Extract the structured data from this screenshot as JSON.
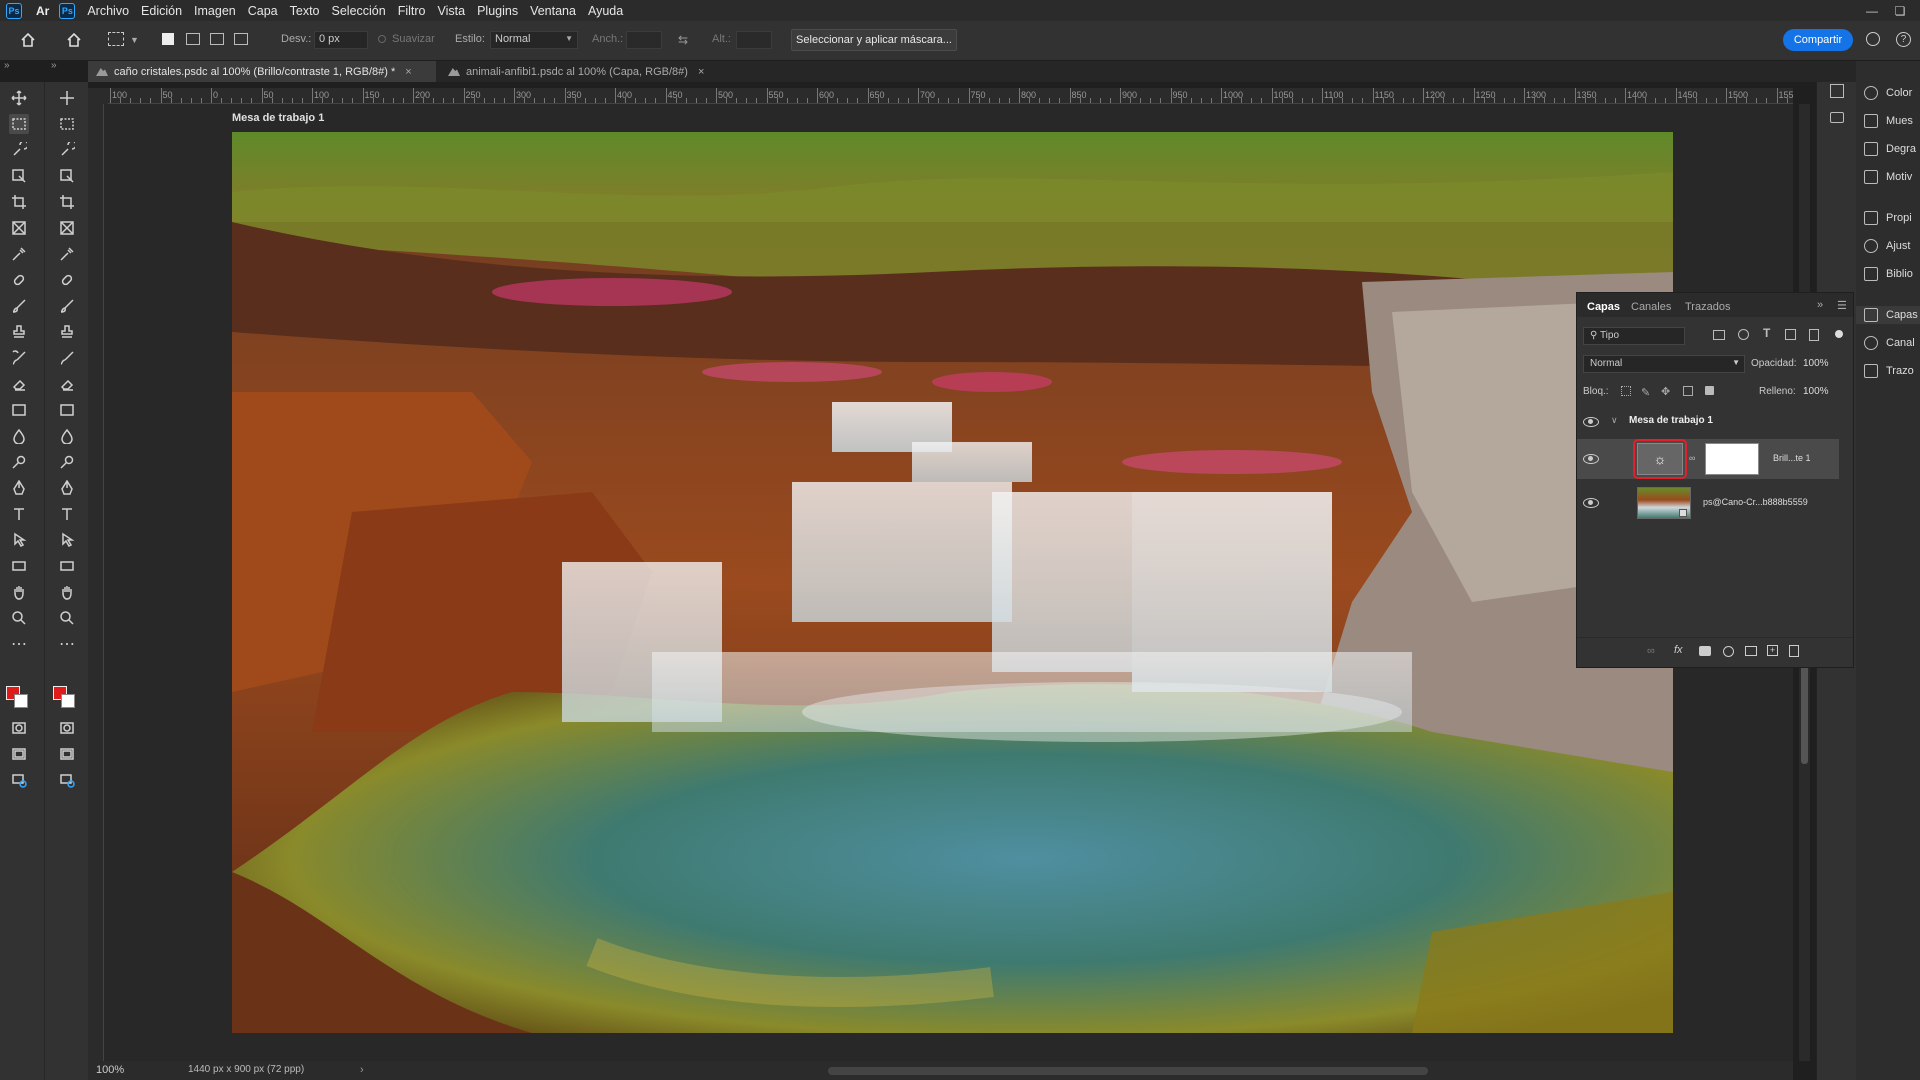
{
  "menubar": {
    "app_icon": "Ps",
    "ar_label": "Ar",
    "ps_label": "Ps",
    "items": [
      "Archivo",
      "Edición",
      "Imagen",
      "Capa",
      "Texto",
      "Selección",
      "Filtro",
      "Vista",
      "Plugins",
      "Ventana",
      "Ayuda"
    ]
  },
  "options": {
    "feather_label": "Desv.:",
    "feather_value": "0 px",
    "antialias_label": "Suavizar",
    "style_label": "Estilo:",
    "style_value": "Normal",
    "width_label": "Anch.:",
    "height_label": "Alt.:",
    "select_mask_label": "Seleccionar y aplicar máscara...",
    "share_label": "Compartir"
  },
  "tabs": [
    {
      "label": "caño cristales.psdc al 100% (Brillo/contraste 1, RGB/8#) *",
      "active": true
    },
    {
      "label": "animali-anfibi1.psdc al 100% (Capa, RGB/8#)",
      "active": false
    }
  ],
  "ruler": {
    "h_labels": [
      "100",
      "50",
      "0",
      "50",
      "100",
      "150",
      "200",
      "250",
      "300",
      "350",
      "400",
      "450",
      "500",
      "550",
      "600",
      "650",
      "700",
      "750",
      "800",
      "850",
      "900",
      "950",
      "1000",
      "1050",
      "1100",
      "1150",
      "1200",
      "1250",
      "1300",
      "1350",
      "1400",
      "1450",
      "1500",
      "155"
    ]
  },
  "artboard": {
    "label": "Mesa de trabajo 1"
  },
  "status": {
    "zoom": "100%",
    "doc_size": "1440 px x 900 px (72 ppp)"
  },
  "dock": {
    "items": [
      "Color",
      "Mues",
      "Degra",
      "Motiv",
      "Propi",
      "Ajust",
      "Biblio",
      "Capas",
      "Canal",
      "Trazo"
    ]
  },
  "layers_panel": {
    "tabs": [
      "Capas",
      "Canales",
      "Trazados"
    ],
    "filter_label": "Tipo",
    "blend_mode": "Normal",
    "opacity_label": "Opacidad:",
    "opacity_value": "100%",
    "lock_label": "Bloq.:",
    "fill_label": "Relleno:",
    "fill_value": "100%",
    "group_name": "Mesa de trabajo 1",
    "layers": [
      {
        "name": "Brill...te 1"
      },
      {
        "name": "ps@Cano-Cr...b888b5559"
      }
    ]
  },
  "colors": {
    "foreground": "#e01b1b",
    "background": "#ffffff",
    "accent": "#1473e6",
    "highlight_ring": "#e0202a"
  }
}
